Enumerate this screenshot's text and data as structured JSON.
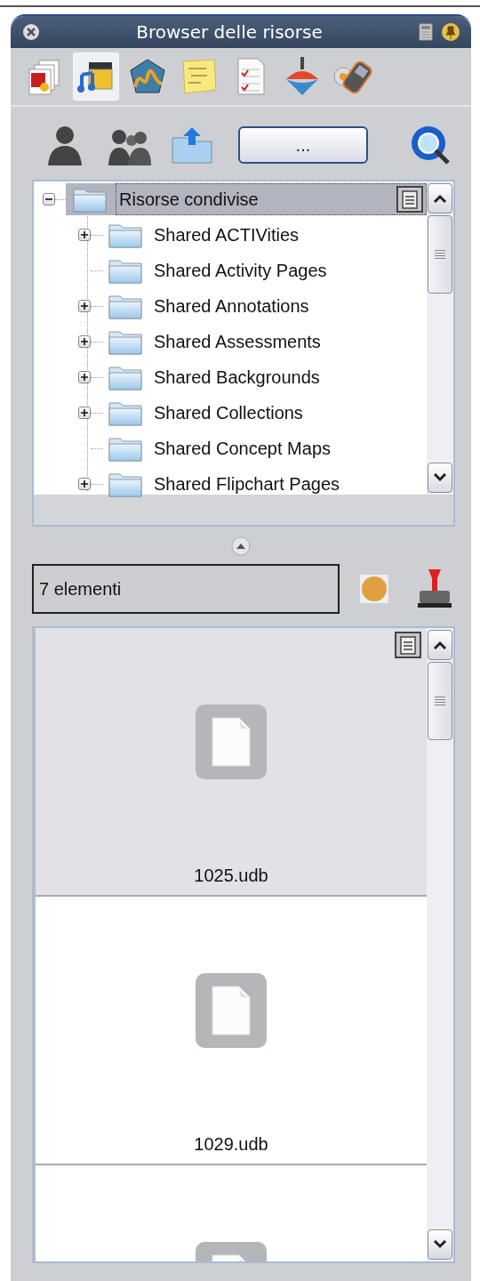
{
  "window": {
    "title": "Browser delle risorse"
  },
  "toolbar_tabs": [
    {
      "kind": "pages",
      "selected": false
    },
    {
      "kind": "media",
      "selected": true
    },
    {
      "kind": "shapes",
      "selected": false
    },
    {
      "kind": "notes",
      "selected": false
    },
    {
      "kind": "checklist",
      "selected": false
    },
    {
      "kind": "top",
      "selected": false
    },
    {
      "kind": "voting",
      "selected": false
    }
  ],
  "browse_button": {
    "label": "..."
  },
  "tree": {
    "root": {
      "label": "Risorse condivise",
      "selected": true,
      "expanded": true,
      "children": [
        {
          "label": "Shared ACTIVities",
          "expandable": true
        },
        {
          "label": "Shared Activity Pages",
          "expandable": false
        },
        {
          "label": "Shared Annotations",
          "expandable": true
        },
        {
          "label": "Shared Assessments",
          "expandable": true
        },
        {
          "label": "Shared Backgrounds",
          "expandable": true
        },
        {
          "label": "Shared Collections",
          "expandable": true
        },
        {
          "label": "Shared Concept Maps",
          "expandable": false
        },
        {
          "label": "Shared Flipchart Pages",
          "expandable": true
        }
      ]
    }
  },
  "status_field": {
    "value": "7 elementi"
  },
  "files": [
    {
      "name": "1025.udb",
      "selected": true
    },
    {
      "name": "1029.udb",
      "selected": false
    },
    {
      "selected": false
    }
  ]
}
